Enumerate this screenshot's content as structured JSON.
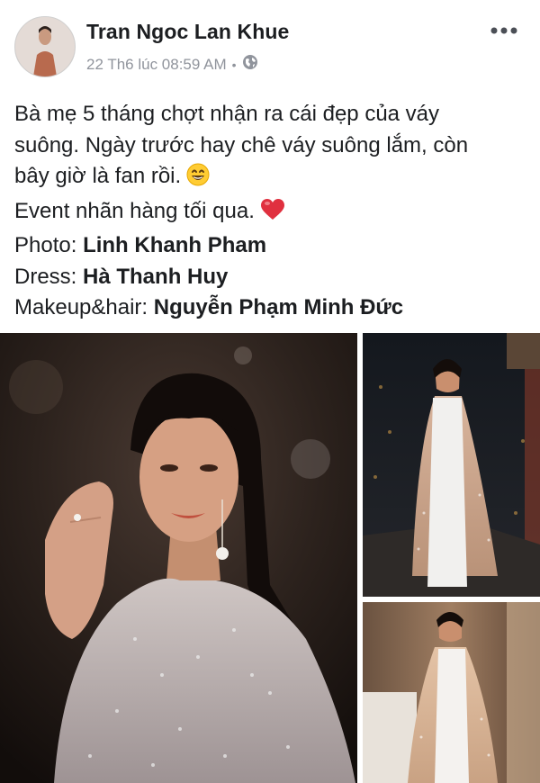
{
  "post": {
    "author": "Tran Ngoc Lan Khue",
    "timestamp": "22 Th6 lúc 08:59 AM",
    "separator": "•",
    "privacy_icon": "globe-icon",
    "more_icon": "more-options-icon",
    "text": {
      "line1": "Bà mẹ 5 tháng chợt nhận ra cái đẹp của váy",
      "line2": "suông. Ngày trước hay chê váy suông lắm, còn",
      "line3": "bây giờ là fan rồi.",
      "line4": "Event nhãn hàng tối qua.",
      "photo_label": "Photo:",
      "photo_credit": "Linh Khanh Pham",
      "dress_label": "Dress:",
      "dress_credit": "Hà Thanh Huy",
      "makeup_label": "Makeup&hair:",
      "makeup_credit": "Nguyễn Phạm Minh Đức"
    },
    "emojis": [
      "grinning-face-emoji",
      "red-heart-emoji"
    ]
  },
  "colors": {
    "name": "#1c1e21",
    "meta": "#90949c",
    "heart": "#e0303f",
    "emoji_face": "#ffcc33"
  }
}
